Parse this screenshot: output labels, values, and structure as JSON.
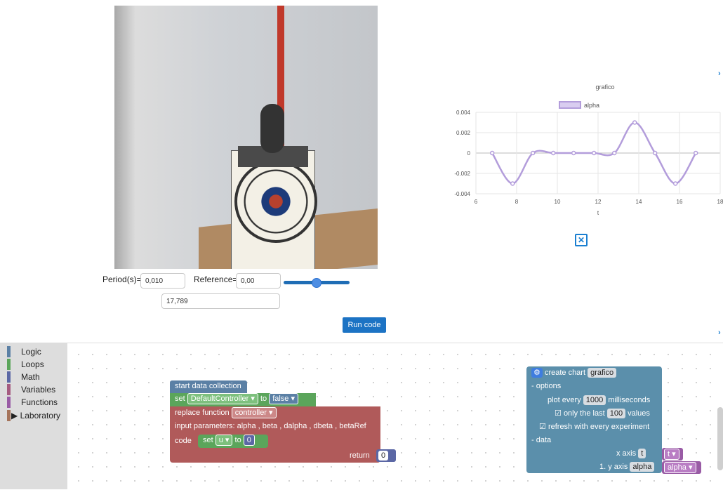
{
  "camera": {
    "alt": "pendulum camera view"
  },
  "controls": {
    "period_label": "Period(s)=",
    "period_value": "0,010",
    "reference_label": "Reference=",
    "reference_value": "0,00",
    "reference_slider_level": 0.45,
    "readout_value": "17,789",
    "run_button": "Run code"
  },
  "chart_data": {
    "type": "line",
    "title": "grafico",
    "legend": [
      "alpha"
    ],
    "xlabel": "t",
    "ylabel": "",
    "xlim": [
      6,
      18
    ],
    "ylim": [
      -0.004,
      0.004
    ],
    "x_ticks": [
      "6",
      "8",
      "10",
      "12",
      "14",
      "16",
      "18"
    ],
    "y_ticks": [
      "0.004",
      "0.002",
      "0",
      "-0.002",
      "-0.004"
    ],
    "series": [
      {
        "name": "alpha",
        "color": "#b39ddb",
        "x": [
          6.8,
          7.8,
          8.8,
          9.8,
          10.8,
          11.8,
          12.8,
          13.8,
          14.8,
          15.8,
          16.8
        ],
        "y": [
          0,
          -0.003,
          0,
          0,
          0,
          0,
          0,
          0.003,
          0,
          -0.003,
          0
        ]
      }
    ]
  },
  "chart_close_icon": "close-icon",
  "toolbox": {
    "items": [
      {
        "label": "Logic",
        "color": "#5b80a5"
      },
      {
        "label": "Loops",
        "color": "#5ba55b"
      },
      {
        "label": "Math",
        "color": "#5b67a5"
      },
      {
        "label": "Variables",
        "color": "#a55b80"
      },
      {
        "label": "Functions",
        "color": "#995ba5"
      },
      {
        "label": "Laboratory",
        "color": "#a5745b",
        "expanded_arrow": "▶"
      }
    ]
  },
  "blocks": {
    "start": "start data collection",
    "set_word": "set",
    "controller_var": "DefaultController",
    "to_word": "to",
    "false_value": "false",
    "replace_function": "replace function",
    "controller_name": "controller",
    "input_params": "input parameters:  alpha , beta , dalpha , dbeta , betaRef",
    "code_word": "code",
    "set_u": "set",
    "u_var": "u",
    "to_u": "to",
    "u_value": "0",
    "return_word": "return",
    "return_value": "0"
  },
  "chart_block": {
    "create_chart": "create chart",
    "chart_name": "grafico",
    "options": "- options",
    "plot_every": "plot every",
    "plot_value": "1000",
    "milliseconds": "milliseconds",
    "only_last": "only the last",
    "only_value": "100",
    "values_word": "values",
    "refresh": "refresh with every experiment",
    "data": "- data",
    "x_axis": "x axis",
    "x_axis_var": "t",
    "x_axis_pill": "t",
    "y_axis": "1. y axis",
    "y_axis_var": "alpha",
    "y_axis_pill": "alpha"
  }
}
